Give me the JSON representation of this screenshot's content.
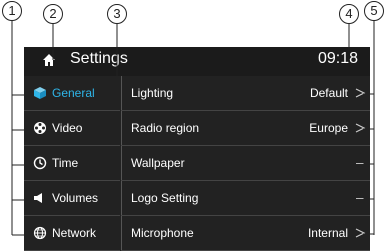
{
  "header": {
    "title": "Settings",
    "clock": "09:18",
    "home_icon": "home-icon"
  },
  "sidebar": {
    "items": [
      {
        "label": "General",
        "icon": "cube-icon",
        "active": true
      },
      {
        "label": "Video",
        "icon": "film-reel-icon",
        "active": false
      },
      {
        "label": "Time",
        "icon": "clock-icon",
        "active": false
      },
      {
        "label": "Volumes",
        "icon": "speaker-icon",
        "active": false
      },
      {
        "label": "Network",
        "icon": "globe-icon",
        "active": false
      }
    ]
  },
  "settings": {
    "rows": [
      {
        "label": "Lighting",
        "value": "Default"
      },
      {
        "label": "Radio region",
        "value": "Europe"
      },
      {
        "label": "Wallpaper",
        "value": ""
      },
      {
        "label": "Logo Setting",
        "value": ""
      },
      {
        "label": "Microphone",
        "value": "Internal"
      }
    ]
  },
  "callouts": [
    "1",
    "2",
    "3",
    "4",
    "5"
  ],
  "colors": {
    "accent": "#2fb5e8",
    "screen_bg": "#222222",
    "header_bg": "#1b1b1b"
  }
}
